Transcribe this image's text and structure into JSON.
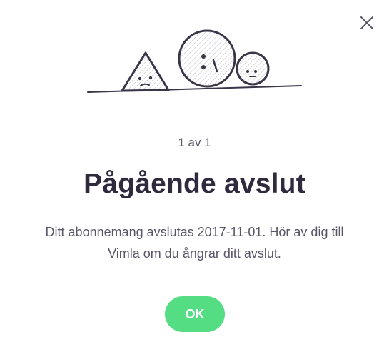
{
  "dialog": {
    "pager": "1 av 1",
    "title": "Pågående avslut",
    "message": "Ditt abonnemang avslutas 2017-11-01. Hör av dig till Vimla om du ångrar ditt avslut.",
    "ok_label": "OK"
  },
  "icons": {
    "close": "close-icon",
    "illustration": "shapes-on-slope-illustration"
  },
  "colors": {
    "accent": "#55dd84",
    "title": "#2f2a3d",
    "body_text": "#5a5566",
    "line": "#3b3548"
  }
}
